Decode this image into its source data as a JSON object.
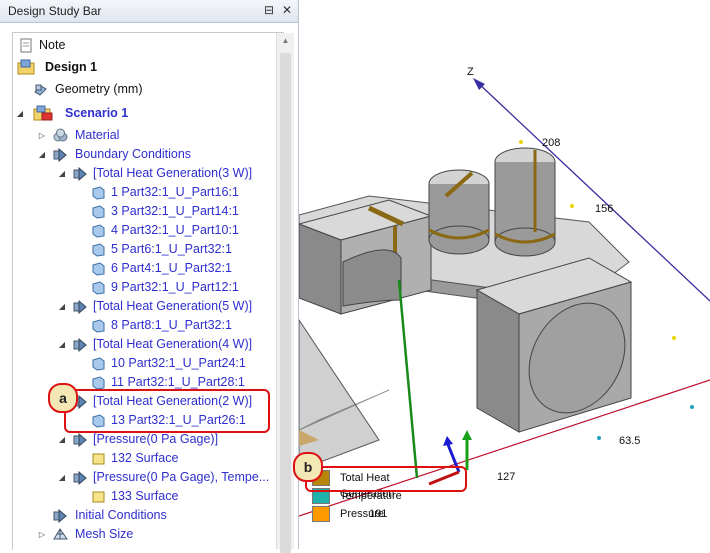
{
  "panel": {
    "title": "Design Study Bar",
    "pin_icon": "pin-icon",
    "close_icon": "close-icon"
  },
  "tree": {
    "note": "Note",
    "design": "Design 1",
    "geometry": "Geometry (mm)",
    "scenario": "Scenario 1",
    "material": "Material",
    "boundary": "Boundary Conditions",
    "hg3": "[Total Heat Generation(3 W)]",
    "hg3_items": [
      "1 Part32:1_U_Part16:1",
      "3 Part32:1_U_Part14:1",
      "4 Part32:1_U_Part10:1",
      "5 Part6:1_U_Part32:1",
      "6 Part4:1_U_Part32:1",
      "9 Part32:1_U_Part12:1"
    ],
    "hg5": "[Total Heat Generation(5 W)]",
    "hg5_item": "8 Part8:1_U_Part32:1",
    "hg4": "[Total Heat Generation(4 W)]",
    "hg4_items": [
      "10 Part32:1_U_Part24:1",
      "11 Part32:1_U_Part28:1"
    ],
    "hg2": "[Total Heat Generation(2 W)]",
    "hg2_item": "13 Part32:1_U_Part26:1",
    "pressure": "[Pressure(0 Pa Gage)]",
    "pressure_item": "132 Surface",
    "pressure_temp": "[Pressure(0 Pa Gage), Tempe...",
    "pressure_temp_item": "133 Surface",
    "initial": "Initial Conditions",
    "mesh": "Mesh Size"
  },
  "callouts": {
    "a": "a",
    "b": "b"
  },
  "viewport": {
    "axis_z": "Z",
    "ticks": [
      "208",
      "156",
      "63.5",
      "127",
      "191"
    ],
    "legend": [
      {
        "label": "Total Heat Generation",
        "color": "#b8860b"
      },
      {
        "label": "Temperature",
        "color": "#20b2aa"
      },
      {
        "label": "Pressure",
        "color": "#ff9900"
      }
    ]
  },
  "colors": {
    "accent_red": "#dd1111",
    "tree_blue": "#2f2fcf"
  }
}
